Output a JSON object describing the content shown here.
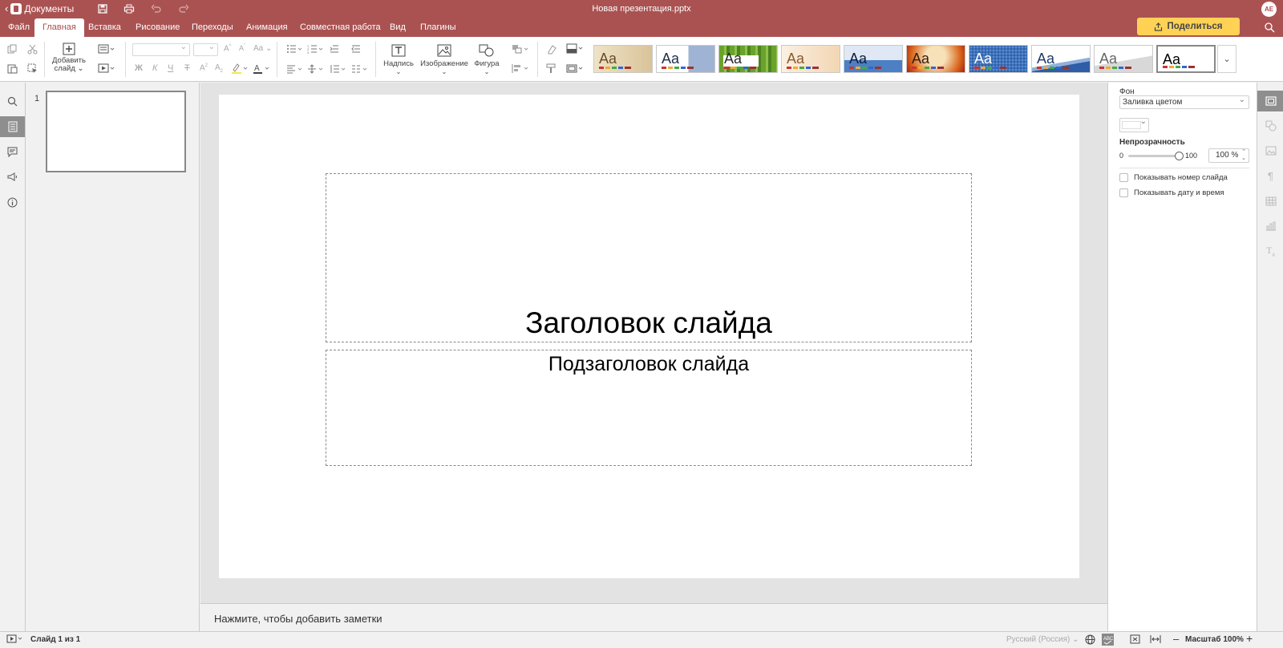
{
  "titlebar": {
    "back_label": "Документы",
    "document_title": "Новая презентация.pptx",
    "user_initials": "AE"
  },
  "tabs": [
    {
      "label": "Файл"
    },
    {
      "label": "Главная"
    },
    {
      "label": "Вставка"
    },
    {
      "label": "Рисование"
    },
    {
      "label": "Переходы"
    },
    {
      "label": "Анимация"
    },
    {
      "label": "Совместная работа"
    },
    {
      "label": "Вид"
    },
    {
      "label": "Плагины"
    }
  ],
  "share_label": "Поделиться",
  "toolbar": {
    "add_slide_label_1": "Добавить",
    "add_slide_label_2": "слайд",
    "textbox_label": "Надпись",
    "image_label": "Изображение",
    "shape_label": "Фигура",
    "themes": [
      {
        "name": "theme-1",
        "bg": "#efe3c6",
        "fg": "#6b4c2a"
      },
      {
        "name": "theme-2",
        "bg": "#dde6f1",
        "fg": "#1f2f4a"
      },
      {
        "name": "theme-3",
        "bg": "#6aa22c",
        "fg": "#ffffff"
      },
      {
        "name": "theme-4",
        "bg": "#f6e4cf",
        "fg": "#8a5a2a"
      },
      {
        "name": "theme-5",
        "bg": "#4c7fc4",
        "fg": "#0e1e3c"
      },
      {
        "name": "theme-6",
        "bg": "#d9641a",
        "fg": "#3a1c0c"
      },
      {
        "name": "theme-7",
        "bg": "#2d5ea6",
        "fg": "#ffffff"
      },
      {
        "name": "theme-8",
        "bg": "#e9eef6",
        "fg": "#1f3b6b"
      },
      {
        "name": "theme-9",
        "bg": "#f0f0f0",
        "fg": "#666666"
      },
      {
        "name": "theme-10",
        "bg": "#ffffff",
        "fg": "#000000"
      }
    ],
    "theme_text": "Aa"
  },
  "thumbnails": {
    "slide_number": "1"
  },
  "slide": {
    "title": "Заголовок слайда",
    "subtitle": "Подзаголовок слайда"
  },
  "notes_placeholder": "Нажмите, чтобы добавить заметки",
  "right_panel": {
    "background_label": "Фон",
    "fill_value": "Заливка цветом",
    "opacity_label": "Непрозрачность",
    "opacity_min": "0",
    "opacity_max": "100",
    "opacity_value": "100 %",
    "opacity_level": 1.0,
    "show_slide_number": "Показывать номер слайда",
    "show_date_time": "Показывать дату и время"
  },
  "statusbar": {
    "slide_info": "Слайд 1 из 1",
    "language": "Русский (Россия)",
    "zoom_label": "Масштаб 100%"
  },
  "colors": {
    "brand": "#aa5252",
    "share_button": "#ffd256"
  }
}
